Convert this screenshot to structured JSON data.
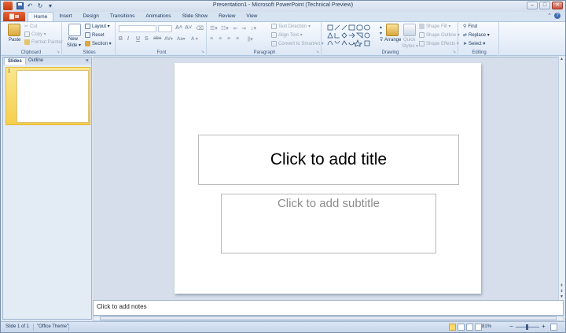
{
  "window": {
    "title": "Presentation1  -  Microsoft PowerPoint (Technical Preview)",
    "minimize": "–",
    "maximize": "□",
    "close": "✕"
  },
  "quick_access": {
    "save_icon": "floppy-disk-icon",
    "undo_icon": "undo-icon",
    "redo_icon": "redo-icon"
  },
  "ribbon_tabs": {
    "file": "",
    "home": "Home",
    "insert": "Insert",
    "design": "Design",
    "transitions": "Transitions",
    "animations": "Animations",
    "slideshow": "Slide Show",
    "review": "Review",
    "view": "View"
  },
  "ribbon": {
    "clipboard": {
      "label": "Clipboard",
      "paste": "Paste",
      "cut": "Cut",
      "copy": "Copy ▾",
      "format_painter": "Format Painter"
    },
    "slides": {
      "label": "Slides",
      "new_slide": "New",
      "new_slide2": "Slide ▾",
      "layout": "Layout ▾",
      "reset": "Reset",
      "section": "Section ▾"
    },
    "font": {
      "label": "Font",
      "bold": "B",
      "italic": "I",
      "underline": "U",
      "strike": "S",
      "shadow": "abc",
      "spacing": "AV▾",
      "case": "Aa▾",
      "color": "A ▾",
      "grow": "A˄",
      "shrink": "A˅"
    },
    "paragraph": {
      "label": "Paragraph",
      "text_direction": "Text Direction ▾",
      "align_text": "Align Text ▾",
      "smartart": "Convert to SmartArt ▾"
    },
    "drawing": {
      "label": "Drawing",
      "arrange": "Arrange",
      "quick_styles": "Quick",
      "quick_styles2": "Styles ▾",
      "shape_fill": "Shape Fill ▾",
      "shape_outline": "Shape Outline ▾",
      "shape_effects": "Shape Effects ▾"
    },
    "editing": {
      "label": "Editing",
      "find": "Find",
      "replace": "Replace ▾",
      "select": "Select ▾"
    }
  },
  "left_pane": {
    "slides_tab": "Slides",
    "outline_tab": "Outline",
    "close": "×",
    "thumb_number": "1"
  },
  "slide": {
    "title_placeholder": "Click to add title",
    "subtitle_placeholder": "Click to add subtitle"
  },
  "notes": {
    "placeholder": "Click to add notes"
  },
  "status_bar": {
    "slide_count": "Slide 1 of 1",
    "theme": "\"Office Theme\"",
    "zoom": "81%",
    "zoom_out": "−",
    "zoom_in": "+"
  },
  "colors": {
    "file_tab": "#d9531e",
    "selection": "#f5cf4c"
  }
}
